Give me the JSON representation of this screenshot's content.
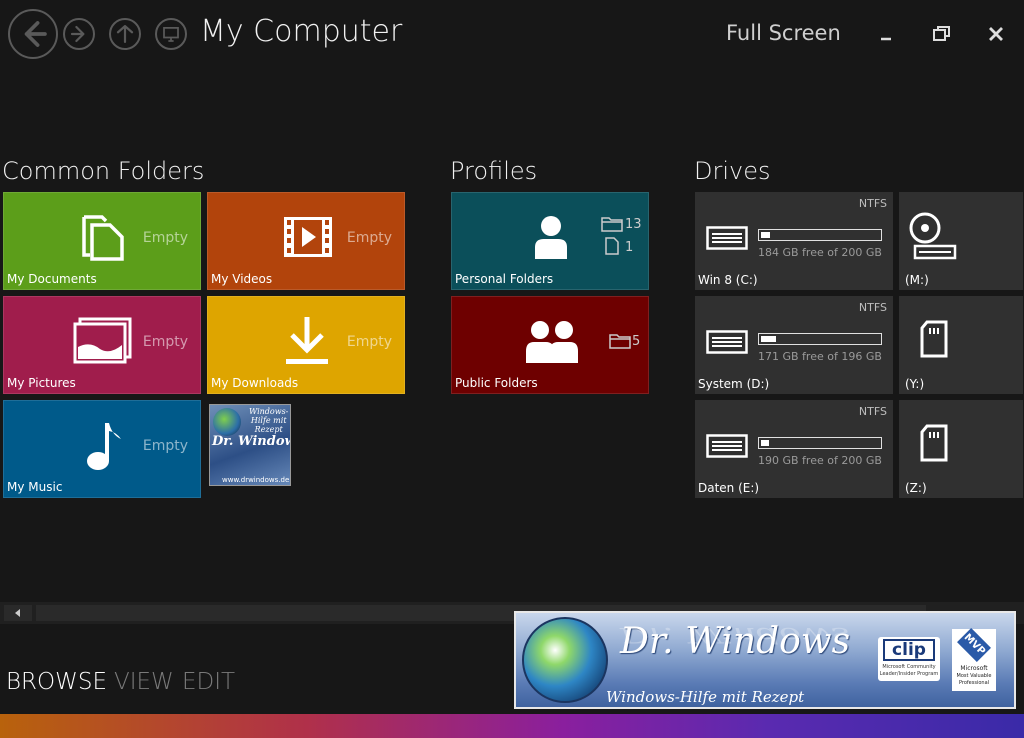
{
  "header": {
    "title": "My Computer",
    "full_screen_label": "Full Screen"
  },
  "sections": {
    "common_folders": "Common Folders",
    "profiles": "Profiles",
    "drives": "Drives"
  },
  "common_folders": [
    {
      "label": "My Documents",
      "status": "Empty",
      "color": "#5c9e1a",
      "icon": "documents-icon"
    },
    {
      "label": "My Videos",
      "status": "Empty",
      "color": "#b2440c",
      "icon": "video-film-icon"
    },
    {
      "label": "My Pictures",
      "status": "Empty",
      "color": "#a01d4c",
      "icon": "pictures-icon"
    },
    {
      "label": "My Downloads",
      "status": "Empty",
      "color": "#dea500",
      "icon": "download-arrow-icon"
    },
    {
      "label": "My Music",
      "status": "Empty",
      "color": "#005a8a",
      "icon": "music-note-icon"
    }
  ],
  "promo_tile": {
    "line1": "Windows-",
    "line2": "Hilfe mit",
    "line3": "Rezept",
    "brand": "Dr. Windows",
    "url": "www.drwindows.de"
  },
  "profiles": [
    {
      "label": "Personal Folders",
      "folder_count": "13",
      "file_count": "1",
      "color": "#0b4f5a",
      "icon": "user-icon"
    },
    {
      "label": "Public Folders",
      "folder_count": "5",
      "color": "#6e0000",
      "icon": "users-group-icon"
    }
  ],
  "drives": [
    {
      "label": "Win 8 (C:)",
      "fs": "NTFS",
      "free": "184 GB free of 200 GB",
      "used_fraction": 0.08
    },
    {
      "label": "System (D:)",
      "fs": "NTFS",
      "free": "171 GB free of 196 GB",
      "used_fraction": 0.13
    },
    {
      "label": "Daten (E:)",
      "fs": "NTFS",
      "free": "190 GB free of 200 GB",
      "used_fraction": 0.05
    }
  ],
  "removable": [
    {
      "label": "(M:)",
      "icon": "optical-drive-icon"
    },
    {
      "label": "(Y:)",
      "icon": "sd-card-icon"
    },
    {
      "label": "(Z:)",
      "icon": "sd-card-icon"
    }
  ],
  "bottom_tabs": [
    "BROWSE",
    "VIEW",
    "EDIT"
  ],
  "banner": {
    "title": "Dr. Windows",
    "reflection": "Dr. Windows",
    "subtitle": "Windows-Hilfe mit Rezept",
    "clip_label": "clip",
    "clip_sub1": "Microsoft Community",
    "clip_sub2": "Leader/Insider Program",
    "mvp_label": "MVP",
    "mvp_sub1": "Microsoft",
    "mvp_sub2": "Most Valuable",
    "mvp_sub3": "Professional"
  }
}
